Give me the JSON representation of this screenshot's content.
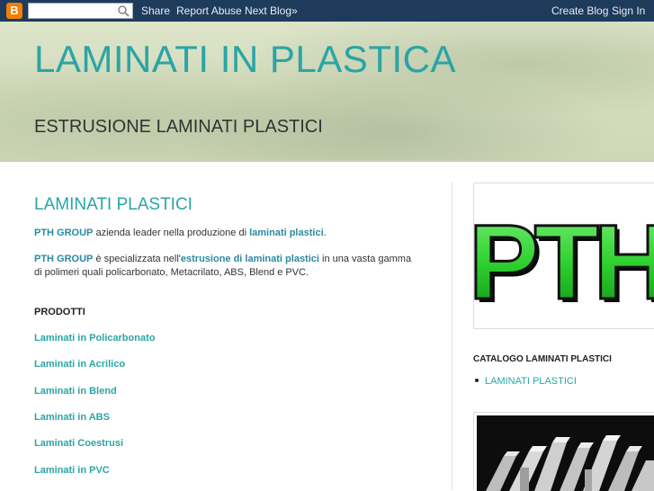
{
  "navbar": {
    "logo_letter": "B",
    "search_value": "",
    "share": "Share",
    "report_abuse": "Report Abuse",
    "next_blog": "Next Blog»",
    "create_blog": "Create Blog",
    "sign_in": "Sign In"
  },
  "header": {
    "title": "LAMINATI IN PLASTICA",
    "description": "ESTRUSIONE LAMINATI PLASTICI"
  },
  "post": {
    "title": "LAMINATI PLASTICI",
    "p1": {
      "strong1": "PTH GROUP",
      "text1": " azienda leader nella produzione di ",
      "strong2": "laminati plastici",
      "text2": "."
    },
    "p2": {
      "strong1": "PTH GROUP",
      "text1": " è specializzata nell'",
      "strong2": "estrusione di laminati plastici",
      "text2": " in una vasta gamma di polimeri quali policarbonato, Metacrilato, ABS, Blend e PVC."
    },
    "products_heading": "PRODOTTI",
    "products": [
      "Laminati in Policarbonato",
      "Laminati in Acrilico",
      "Laminati in Blend",
      "Laminati in ABS",
      "Laminati Coestrusi",
      "Laminati in PVC"
    ]
  },
  "sidebar": {
    "logo_text": "PTH",
    "catalog_heading": "CATALOGO LAMINATI PLASTICI",
    "catalog_items": [
      "LAMINATI PLASTICI"
    ]
  },
  "colors": {
    "navbar": "#1e3b5c",
    "accent": "#2aa5a5",
    "logo_green": "#2fd12f"
  }
}
